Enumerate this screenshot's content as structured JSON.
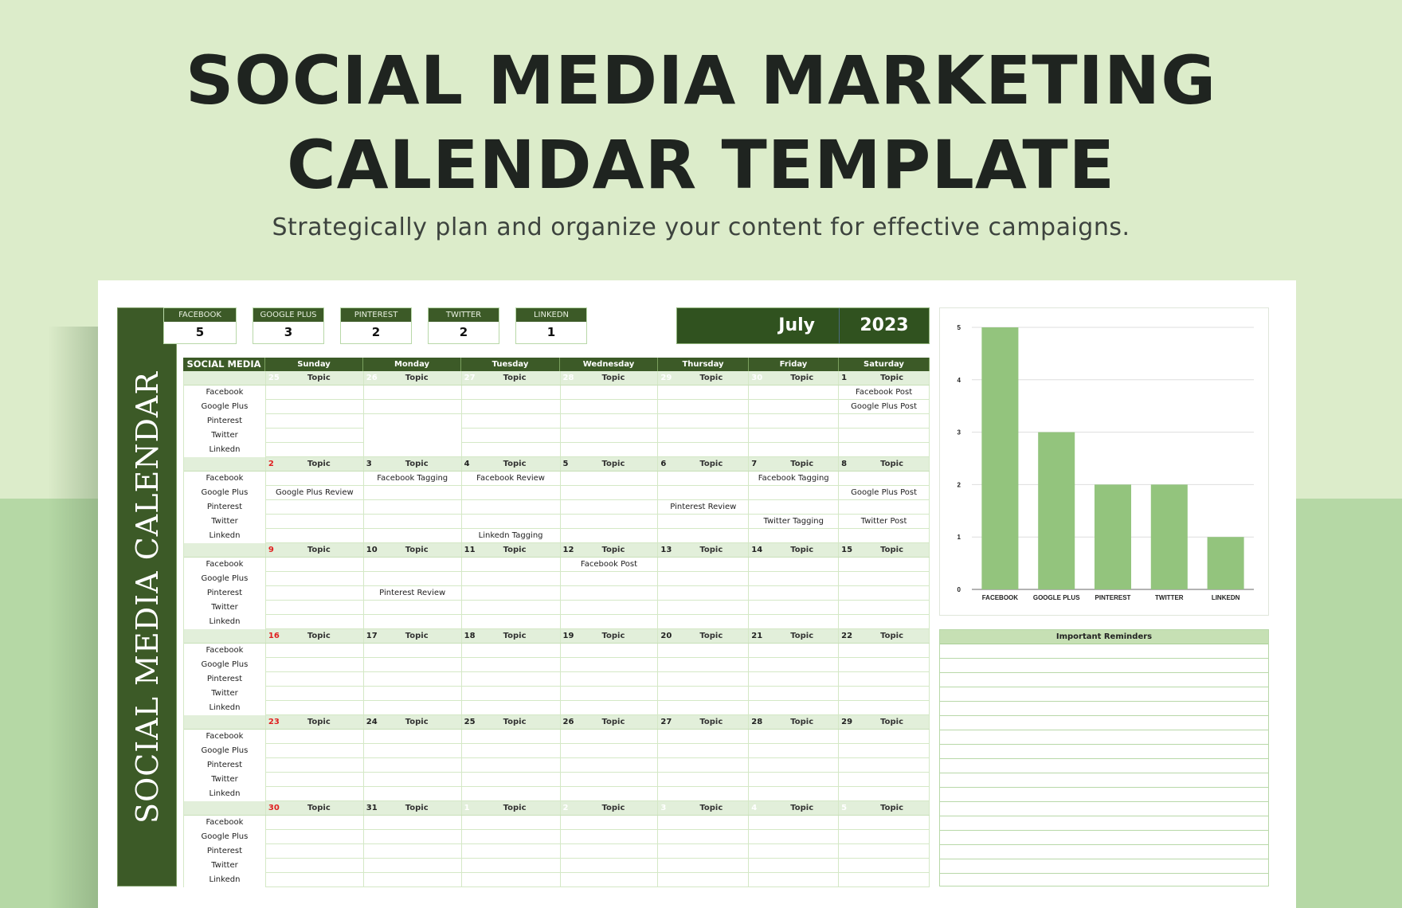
{
  "header": {
    "title_line1": "SOCIAL MEDIA MARKETING",
    "title_line2": "CALENDAR TEMPLATE",
    "subtitle": "Strategically plan and organize your content for effective campaigns."
  },
  "banner": {
    "text": "SOCIAL MEDIA CALENDAR"
  },
  "counters": [
    {
      "label": "FACEBOOK",
      "value": "5"
    },
    {
      "label": "GOOGLE PLUS",
      "value": "3"
    },
    {
      "label": "PINTEREST",
      "value": "2"
    },
    {
      "label": "TWITTER",
      "value": "2"
    },
    {
      "label": "LINKEDN",
      "value": "1"
    }
  ],
  "period": {
    "month": "July",
    "year": "2023"
  },
  "calendar": {
    "header": [
      "SOCIAL MEDIA",
      "Sunday",
      "Monday",
      "Tuesday",
      "Wednesday",
      "Thursday",
      "Friday",
      "Saturday"
    ],
    "topic_label": "Topic",
    "platforms": [
      "Facebook",
      "Google Plus",
      "Pinterest",
      "Twitter",
      "Linkedn"
    ],
    "weeks": [
      {
        "days": [
          {
            "num": "25",
            "state": "faded"
          },
          {
            "num": "26",
            "state": "faded"
          },
          {
            "num": "27",
            "state": "faded"
          },
          {
            "num": "28",
            "state": "faded"
          },
          {
            "num": "29",
            "state": "faded"
          },
          {
            "num": "30",
            "state": "faded"
          },
          {
            "num": "1",
            "state": "normal"
          }
        ],
        "entries": [
          [
            "",
            "",
            "",
            "",
            "",
            "",
            "Facebook Post"
          ],
          [
            "",
            "",
            "",
            "",
            "",
            "",
            "Google Plus Post"
          ],
          [
            "",
            "",
            "",
            "",
            "",
            "",
            ""
          ],
          [
            "",
            "",
            "",
            "",
            "",
            "",
            ""
          ],
          [
            "",
            "",
            "",
            "",
            "",
            "",
            ""
          ]
        ]
      },
      {
        "days": [
          {
            "num": "2",
            "state": "sunday"
          },
          {
            "num": "3",
            "state": "normal"
          },
          {
            "num": "4",
            "state": "normal"
          },
          {
            "num": "5",
            "state": "normal"
          },
          {
            "num": "6",
            "state": "normal"
          },
          {
            "num": "7",
            "state": "normal"
          },
          {
            "num": "8",
            "state": "normal"
          }
        ],
        "entries": [
          [
            "",
            "Facebook Tagging",
            "Facebook Review",
            "",
            "",
            "Facebook Tagging",
            ""
          ],
          [
            "Google Plus Review",
            "",
            "",
            "",
            "",
            "",
            "Google Plus Post"
          ],
          [
            "",
            "",
            "",
            "",
            "Pinterest Review",
            "",
            ""
          ],
          [
            "",
            "",
            "",
            "",
            "",
            "Twitter Tagging",
            "Twitter Post"
          ],
          [
            "",
            "",
            "Linkedn Tagging",
            "",
            "",
            "",
            ""
          ]
        ]
      },
      {
        "days": [
          {
            "num": "9",
            "state": "sunday"
          },
          {
            "num": "10",
            "state": "normal"
          },
          {
            "num": "11",
            "state": "normal"
          },
          {
            "num": "12",
            "state": "normal"
          },
          {
            "num": "13",
            "state": "normal"
          },
          {
            "num": "14",
            "state": "normal"
          },
          {
            "num": "15",
            "state": "normal"
          }
        ],
        "entries": [
          [
            "",
            "",
            "",
            "Facebook Post",
            "",
            "",
            ""
          ],
          [
            "",
            "",
            "",
            "",
            "",
            "",
            ""
          ],
          [
            "",
            "Pinterest Review",
            "",
            "",
            "",
            "",
            ""
          ],
          [
            "",
            "",
            "",
            "",
            "",
            "",
            ""
          ],
          [
            "",
            "",
            "",
            "",
            "",
            "",
            ""
          ]
        ]
      },
      {
        "days": [
          {
            "num": "16",
            "state": "sunday"
          },
          {
            "num": "17",
            "state": "normal"
          },
          {
            "num": "18",
            "state": "normal"
          },
          {
            "num": "19",
            "state": "normal"
          },
          {
            "num": "20",
            "state": "normal"
          },
          {
            "num": "21",
            "state": "normal"
          },
          {
            "num": "22",
            "state": "normal"
          }
        ],
        "entries": [
          [
            "",
            "",
            "",
            "",
            "",
            "",
            ""
          ],
          [
            "",
            "",
            "",
            "",
            "",
            "",
            ""
          ],
          [
            "",
            "",
            "",
            "",
            "",
            "",
            ""
          ],
          [
            "",
            "",
            "",
            "",
            "",
            "",
            ""
          ],
          [
            "",
            "",
            "",
            "",
            "",
            "",
            ""
          ]
        ]
      },
      {
        "days": [
          {
            "num": "23",
            "state": "sunday"
          },
          {
            "num": "24",
            "state": "normal"
          },
          {
            "num": "25",
            "state": "normal"
          },
          {
            "num": "26",
            "state": "normal"
          },
          {
            "num": "27",
            "state": "normal"
          },
          {
            "num": "28",
            "state": "normal"
          },
          {
            "num": "29",
            "state": "normal"
          }
        ],
        "entries": [
          [
            "",
            "",
            "",
            "",
            "",
            "",
            ""
          ],
          [
            "",
            "",
            "",
            "",
            "",
            "",
            ""
          ],
          [
            "",
            "",
            "",
            "",
            "",
            "",
            ""
          ],
          [
            "",
            "",
            "",
            "",
            "",
            "",
            ""
          ],
          [
            "",
            "",
            "",
            "",
            "",
            "",
            ""
          ]
        ]
      },
      {
        "days": [
          {
            "num": "30",
            "state": "sunday"
          },
          {
            "num": "31",
            "state": "normal"
          },
          {
            "num": "1",
            "state": "faded"
          },
          {
            "num": "2",
            "state": "faded"
          },
          {
            "num": "3",
            "state": "faded"
          },
          {
            "num": "4",
            "state": "faded"
          },
          {
            "num": "5",
            "state": "faded"
          }
        ],
        "entries": [
          [
            "",
            "",
            "",
            "",
            "",
            "",
            ""
          ],
          [
            "",
            "",
            "",
            "",
            "",
            "",
            ""
          ],
          [
            "",
            "",
            "",
            "",
            "",
            "",
            ""
          ],
          [
            "",
            "",
            "",
            "",
            "",
            "",
            ""
          ],
          [
            "",
            "",
            "",
            "",
            "",
            "",
            ""
          ]
        ]
      }
    ]
  },
  "reminders": {
    "title": "Important Reminders",
    "lines": 16
  },
  "colors": {
    "dark_green": "#3c5a27",
    "bar_green": "#93c47d",
    "light_green": "#e2efda",
    "sunday_red": "#e02020"
  },
  "chart_data": {
    "type": "bar",
    "categories": [
      "FACEBOOK",
      "GOOGLE PLUS",
      "PINTEREST",
      "TWITTER",
      "LINKEDN"
    ],
    "values": [
      5,
      3,
      2,
      2,
      1
    ],
    "title": "",
    "xlabel": "",
    "ylabel": "",
    "ylim": [
      0,
      5
    ],
    "yticks": [
      0,
      1,
      2,
      3,
      4,
      5
    ],
    "grid": true,
    "legend": "none"
  }
}
